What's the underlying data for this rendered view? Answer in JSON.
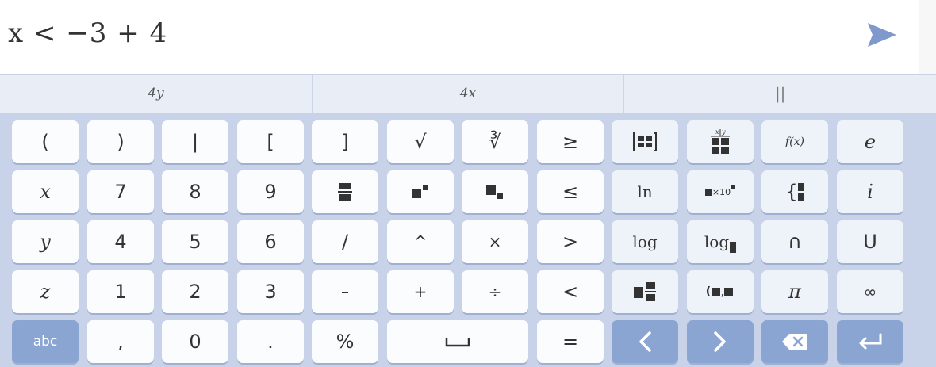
{
  "input": {
    "expression": "x < −3 + 4"
  },
  "suggestions": [
    "4y",
    "4x",
    "||"
  ],
  "keys": [
    [
      "(",
      ")",
      "|",
      "[",
      "]",
      "√",
      "∛",
      "≥",
      "",
      "",
      "f(x)",
      "e"
    ],
    [
      "x",
      "7",
      "8",
      "9",
      "",
      "",
      "",
      "≤",
      "ln",
      "×10",
      "{",
      "i"
    ],
    [
      "y",
      "4",
      "5",
      "6",
      "/",
      "^",
      "×",
      ">",
      "log",
      "log",
      "∩",
      "U"
    ],
    [
      "z",
      "1",
      "2",
      "3",
      "–",
      "+",
      "÷",
      "<",
      "",
      "(",
      "π",
      "∞"
    ],
    [
      "abc",
      ",",
      "0",
      ".",
      "%",
      "",
      "=",
      "",
      "",
      "",
      ""
    ]
  ],
  "colors": {
    "key_bg": "#fbfcfe",
    "keyboard_bg": "#c8d2e8",
    "blue_key": "#8ba5d2",
    "send_icon": "#7f99cc"
  }
}
